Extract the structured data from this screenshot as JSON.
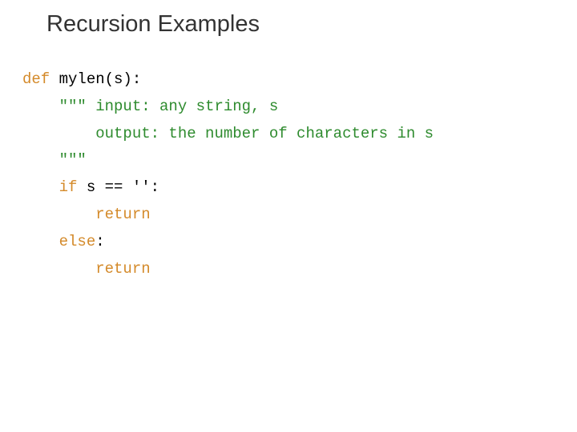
{
  "title": "Recursion Examples",
  "code": {
    "l1": {
      "kw": "def",
      "rest": " mylen(s):"
    },
    "l2": "    \"\"\" input: any string, s",
    "l3": "        output: the number of characters in s",
    "l4": "    \"\"\"",
    "l5": {
      "pre": "    ",
      "kw": "if",
      "rest": " s == '':"
    },
    "l6": {
      "pre": "        ",
      "kw": "return"
    },
    "l7": {
      "pre": "    ",
      "kw": "else",
      "colon": ":"
    },
    "l8": {
      "pre": "        ",
      "kw": "return"
    }
  }
}
